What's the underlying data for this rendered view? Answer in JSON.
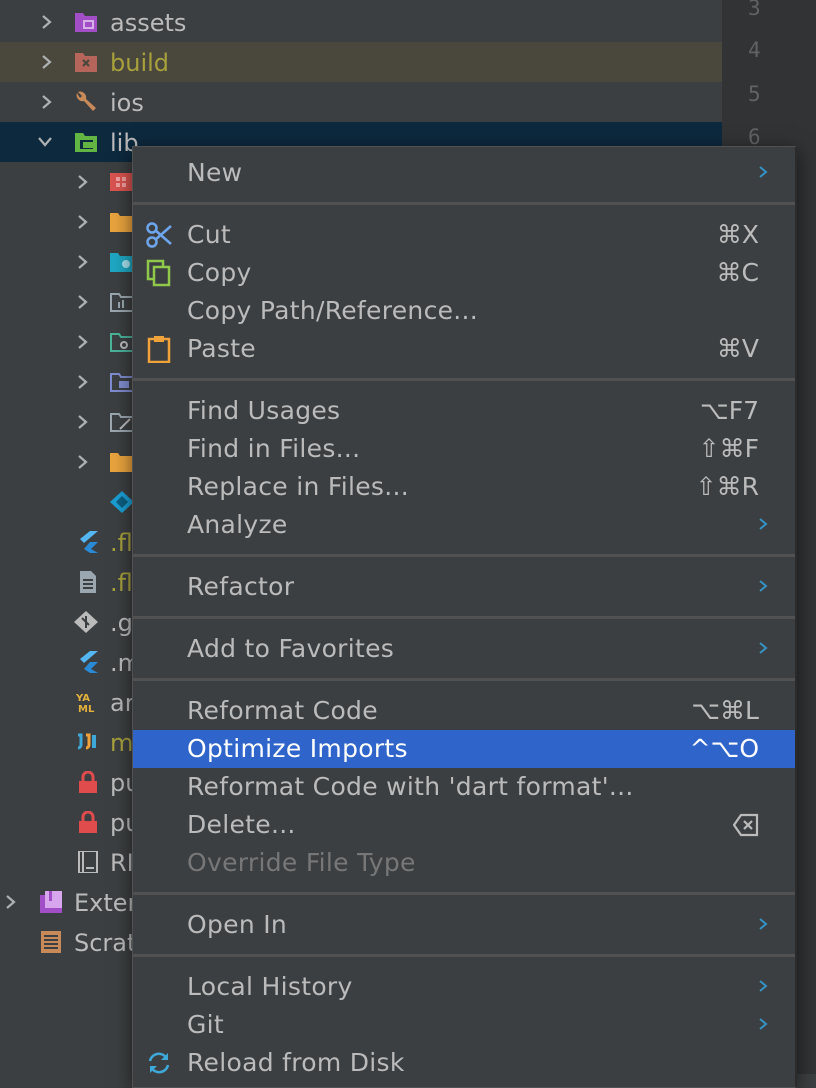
{
  "gutter": {
    "line_numbers": [
      "3",
      "4",
      "5",
      "6"
    ]
  },
  "tree": {
    "assets": "assets",
    "build": "build",
    "ios": "ios",
    "lib": "lib",
    "flutter_plugins": ".fl",
    "flutter_plugins_deps": ".fl",
    "gitignore": ".g",
    "metadata": ".m",
    "analysis": "ar",
    "iml": "m",
    "pubspec_lock": "pu",
    "pubspec_yaml": "pu",
    "readme": "RI",
    "external_libraries": "Exter",
    "scratches": "Scrat"
  },
  "menu": {
    "new": "New",
    "cut": "Cut",
    "cut_sc": "⌘X",
    "copy": "Copy",
    "copy_sc": "⌘C",
    "copy_path": "Copy Path/Reference...",
    "paste": "Paste",
    "paste_sc": "⌘V",
    "find_usages": "Find Usages",
    "find_usages_sc": "⌥F7",
    "find_in_files": "Find in Files...",
    "find_in_files_sc": "⇧⌘F",
    "replace_in_files": "Replace in Files...",
    "replace_in_files_sc": "⇧⌘R",
    "analyze": "Analyze",
    "refactor": "Refactor",
    "add_to_favorites": "Add to Favorites",
    "reformat_code": "Reformat Code",
    "reformat_code_sc": "⌥⌘L",
    "optimize_imports": "Optimize Imports",
    "optimize_imports_sc": "^⌥O",
    "reformat_dart": "Reformat Code with 'dart format'...",
    "delete": "Delete...",
    "override_file_type": "Override File Type",
    "open_in": "Open In",
    "local_history": "Local History",
    "git": "Git",
    "reload_from_disk": "Reload from Disk"
  },
  "colors": {
    "background": "#3c3f41",
    "selection": "#2f65ca",
    "build_row": "#4a473c",
    "lib_row": "#0d293e",
    "accent_chevron": "#3592c4"
  }
}
